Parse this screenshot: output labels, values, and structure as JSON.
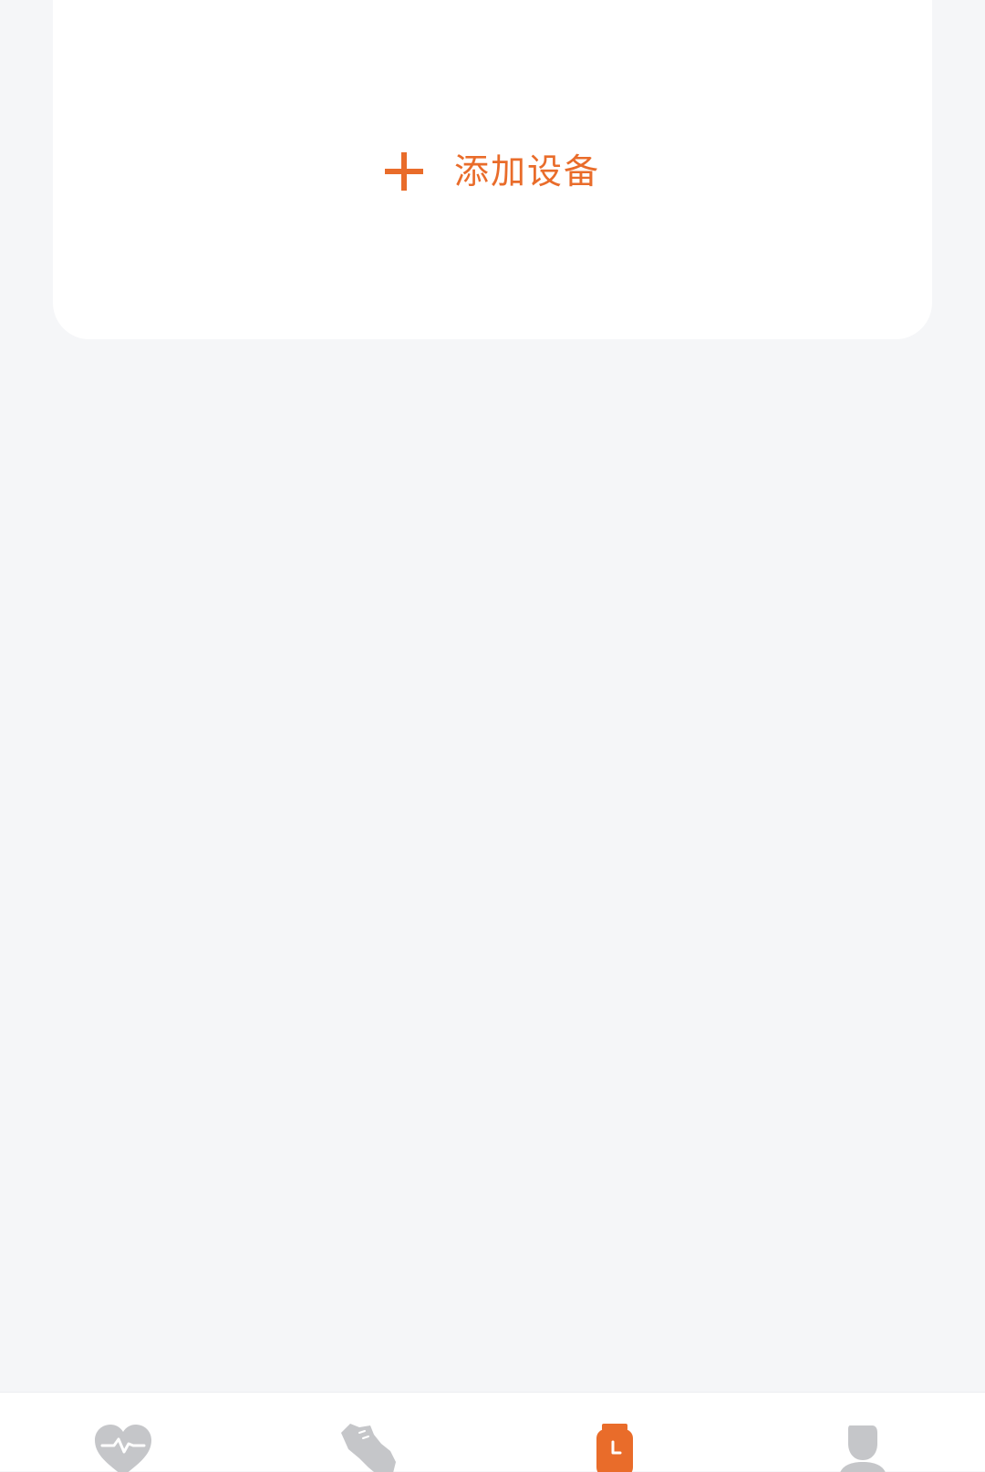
{
  "device_card": {
    "add_device_label": "添加设备",
    "add_icon": "plus-icon"
  },
  "tab_bar": {
    "tabs": [
      {
        "icon": "heart-pulse-icon",
        "active": false
      },
      {
        "icon": "running-shoe-icon",
        "active": false
      },
      {
        "icon": "smartwatch-icon",
        "active": true
      },
      {
        "icon": "person-icon",
        "active": false
      }
    ]
  },
  "colors": {
    "accent": "#e96c2a",
    "inactive_icon": "#c5c6c9",
    "background": "#f5f6f8",
    "card": "#ffffff"
  }
}
